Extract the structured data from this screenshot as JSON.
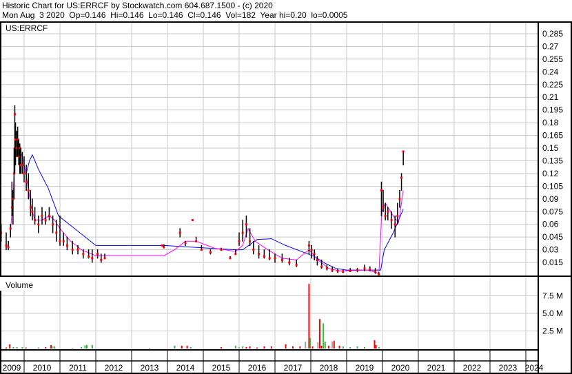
{
  "header": {
    "line1": "Historic Chart for US:ERRCF by Stockwatch.com 604.687.1500 - (c) 2020",
    "line2": "Mon Aug  3 2020  Op=0.146  Hi=0.146  Lo=0.146  Cl=0.146  Vol=182  Year hi=0.20  lo=0.0005"
  },
  "colors": {
    "grid": "#c8c8c8",
    "bar": "#000000",
    "close": "#ff0000",
    "ma_long": "#0000ff",
    "ma_short": "#ff00ff",
    "vol_down": "#ff0000",
    "vol_up": "#3cb43c",
    "vol_flat": "#a0a0a0"
  },
  "chart_data": [
    {
      "type": "line",
      "title": "US:ERRCF",
      "ylim": [
        0,
        0.3
      ],
      "yticks": [
        "0.015",
        "0.03",
        "0.045",
        "0.06",
        "0.075",
        "0.09",
        "0.105",
        "0.12",
        "0.135",
        "0.15",
        "0.165",
        "0.18",
        "0.195",
        "0.21",
        "0.225",
        "0.24",
        "0.255",
        "0.27",
        "0.285"
      ],
      "xlim": [
        2009.33,
        2024.45
      ],
      "xticks": [
        "2009",
        "2010",
        "2011",
        "2012",
        "2013",
        "2014",
        "2015",
        "2016",
        "2017",
        "2018",
        "2019",
        "2020",
        "2021",
        "2022",
        "2023",
        "2024"
      ],
      "ohlc_fields": [
        "year",
        "low",
        "high",
        "close"
      ],
      "bars": [
        [
          2009.33,
          0.045,
          0.095,
          0.09
        ],
        [
          2009.36,
          0.04,
          0.06,
          0.05
        ],
        [
          2009.5,
          0.03,
          0.05,
          0.035
        ],
        [
          2009.56,
          0.03,
          0.04,
          0.033
        ],
        [
          2009.62,
          0.045,
          0.06,
          0.055
        ],
        [
          2009.66,
          0.07,
          0.11,
          0.08
        ],
        [
          2009.69,
          0.06,
          0.1,
          0.09
        ],
        [
          2009.72,
          0.09,
          0.15,
          0.12
        ],
        [
          2009.74,
          0.12,
          0.2,
          0.19
        ],
        [
          2009.76,
          0.13,
          0.18,
          0.16
        ],
        [
          2009.79,
          0.14,
          0.17,
          0.15
        ],
        [
          2009.82,
          0.14,
          0.175,
          0.16
        ],
        [
          2009.85,
          0.13,
          0.16,
          0.14
        ],
        [
          2009.88,
          0.12,
          0.155,
          0.15
        ],
        [
          2009.91,
          0.12,
          0.15,
          0.13
        ],
        [
          2009.95,
          0.12,
          0.145,
          0.13
        ],
        [
          2010.0,
          0.11,
          0.14,
          0.12
        ],
        [
          2010.06,
          0.1,
          0.13,
          0.11
        ],
        [
          2010.12,
          0.09,
          0.12,
          0.1
        ],
        [
          2010.18,
          0.07,
          0.1,
          0.08
        ],
        [
          2010.23,
          0.065,
          0.09,
          0.075
        ],
        [
          2010.3,
          0.06,
          0.08,
          0.065
        ],
        [
          2010.4,
          0.05,
          0.07,
          0.06
        ],
        [
          2010.5,
          0.06,
          0.08,
          0.07
        ],
        [
          2010.6,
          0.06,
          0.075,
          0.065
        ],
        [
          2010.7,
          0.065,
          0.08,
          0.07
        ],
        [
          2010.8,
          0.05,
          0.07,
          0.06
        ],
        [
          2010.9,
          0.04,
          0.065,
          0.05
        ],
        [
          2011.0,
          0.035,
          0.07,
          0.04
        ],
        [
          2011.1,
          0.035,
          0.05,
          0.04
        ],
        [
          2011.2,
          0.03,
          0.045,
          0.035
        ],
        [
          2011.35,
          0.025,
          0.04,
          0.03
        ],
        [
          2011.5,
          0.025,
          0.035,
          0.03
        ],
        [
          2011.65,
          0.02,
          0.03,
          0.025
        ],
        [
          2011.8,
          0.02,
          0.03,
          0.022
        ],
        [
          2011.9,
          0.015,
          0.03,
          0.02
        ],
        [
          2012.05,
          0.02,
          0.03,
          0.025
        ],
        [
          2012.15,
          0.015,
          0.025,
          0.018
        ],
        [
          2012.25,
          0.02,
          0.025,
          0.02
        ],
        [
          2013.85,
          0.035,
          0.035,
          0.035
        ],
        [
          2013.9,
          0.032,
          0.036,
          0.033
        ],
        [
          2014.35,
          0.045,
          0.055,
          0.05
        ],
        [
          2014.5,
          0.035,
          0.04,
          0.038
        ],
        [
          2014.7,
          0.065,
          0.065,
          0.065
        ],
        [
          2014.8,
          0.04,
          0.045,
          0.04
        ],
        [
          2014.95,
          0.03,
          0.035,
          0.03
        ],
        [
          2015.2,
          0.025,
          0.03,
          0.027
        ],
        [
          2015.5,
          0.03,
          0.032,
          0.03
        ],
        [
          2015.75,
          0.02,
          0.022,
          0.02
        ],
        [
          2015.9,
          0.025,
          0.03,
          0.025
        ],
        [
          2016.0,
          0.035,
          0.05,
          0.04
        ],
        [
          2016.1,
          0.04,
          0.065,
          0.05
        ],
        [
          2016.2,
          0.045,
          0.07,
          0.06
        ],
        [
          2016.3,
          0.035,
          0.055,
          0.04
        ],
        [
          2016.4,
          0.025,
          0.04,
          0.03
        ],
        [
          2016.55,
          0.02,
          0.035,
          0.025
        ],
        [
          2016.7,
          0.02,
          0.03,
          0.022
        ],
        [
          2016.85,
          0.018,
          0.03,
          0.02
        ],
        [
          2017.0,
          0.015,
          0.025,
          0.02
        ],
        [
          2017.2,
          0.015,
          0.025,
          0.018
        ],
        [
          2017.4,
          0.012,
          0.02,
          0.015
        ],
        [
          2017.6,
          0.01,
          0.018,
          0.012
        ],
        [
          2017.95,
          0.025,
          0.04,
          0.035
        ],
        [
          2018.02,
          0.02,
          0.035,
          0.03
        ],
        [
          2018.1,
          0.018,
          0.03,
          0.025
        ],
        [
          2018.18,
          0.012,
          0.022,
          0.018
        ],
        [
          2018.3,
          0.008,
          0.018,
          0.01
        ],
        [
          2018.45,
          0.006,
          0.012,
          0.008
        ],
        [
          2018.6,
          0.004,
          0.01,
          0.006
        ],
        [
          2018.75,
          0.003,
          0.007,
          0.005
        ],
        [
          2018.9,
          0.003,
          0.006,
          0.004
        ],
        [
          2019.1,
          0.004,
          0.008,
          0.005
        ],
        [
          2019.3,
          0.004,
          0.008,
          0.006
        ],
        [
          2019.5,
          0.005,
          0.012,
          0.008
        ],
        [
          2019.65,
          0.005,
          0.01,
          0.007
        ],
        [
          2019.8,
          0.002,
          0.008,
          0.004
        ],
        [
          2019.9,
          0.0005,
          0.003,
          0.001
        ],
        [
          2019.97,
          0.07,
          0.11,
          0.1
        ],
        [
          2020.02,
          0.075,
          0.1,
          0.08
        ],
        [
          2020.08,
          0.065,
          0.085,
          0.07
        ],
        [
          2020.15,
          0.065,
          0.08,
          0.075
        ],
        [
          2020.25,
          0.055,
          0.075,
          0.065
        ],
        [
          2020.35,
          0.045,
          0.07,
          0.06
        ],
        [
          2020.42,
          0.06,
          0.085,
          0.07
        ],
        [
          2020.48,
          0.08,
          0.1,
          0.09
        ],
        [
          2020.53,
          0.1,
          0.12,
          0.115
        ],
        [
          2020.58,
          0.13,
          0.146,
          0.146
        ]
      ],
      "ma_long": [
        [
          2010.06,
          0.12
        ],
        [
          2010.15,
          0.135
        ],
        [
          2010.23,
          0.142
        ],
        [
          2010.4,
          0.125
        ],
        [
          2010.67,
          0.103
        ],
        [
          2010.96,
          0.07
        ],
        [
          2011.44,
          0.054
        ],
        [
          2012.0,
          0.035
        ],
        [
          2013.9,
          0.035
        ],
        [
          2015.9,
          0.03
        ],
        [
          2016.1,
          0.03
        ],
        [
          2016.5,
          0.042
        ],
        [
          2016.9,
          0.043
        ],
        [
          2017.3,
          0.035
        ],
        [
          2017.8,
          0.027
        ],
        [
          2018.1,
          0.022
        ],
        [
          2018.4,
          0.014
        ],
        [
          2018.7,
          0.008
        ],
        [
          2019.0,
          0.006
        ],
        [
          2019.95,
          0.006
        ],
        [
          2020.05,
          0.03
        ],
        [
          2020.3,
          0.05
        ],
        [
          2020.58,
          0.078
        ]
      ],
      "ma_short": [
        [
          2009.62,
          0.05
        ],
        [
          2009.7,
          0.1
        ],
        [
          2009.76,
          0.17
        ],
        [
          2009.85,
          0.15
        ],
        [
          2009.95,
          0.14
        ],
        [
          2010.05,
          0.12
        ],
        [
          2010.2,
          0.08
        ],
        [
          2010.3,
          0.065
        ],
        [
          2010.5,
          0.065
        ],
        [
          2010.7,
          0.07
        ],
        [
          2010.85,
          0.065
        ],
        [
          2011.0,
          0.055
        ],
        [
          2011.3,
          0.04
        ],
        [
          2011.6,
          0.03
        ],
        [
          2012.0,
          0.023
        ],
        [
          2012.3,
          0.023
        ],
        [
          2013.9,
          0.023
        ],
        [
          2014.2,
          0.03
        ],
        [
          2014.5,
          0.04
        ],
        [
          2014.8,
          0.04
        ],
        [
          2015.3,
          0.032
        ],
        [
          2015.9,
          0.028
        ],
        [
          2016.1,
          0.035
        ],
        [
          2016.25,
          0.055
        ],
        [
          2016.45,
          0.04
        ],
        [
          2016.8,
          0.03
        ],
        [
          2017.2,
          0.02
        ],
        [
          2017.6,
          0.018
        ],
        [
          2017.95,
          0.03
        ],
        [
          2018.2,
          0.018
        ],
        [
          2018.5,
          0.008
        ],
        [
          2018.8,
          0.005
        ],
        [
          2019.6,
          0.006
        ],
        [
          2019.9,
          0.002
        ],
        [
          2019.98,
          0.075
        ],
        [
          2020.08,
          0.085
        ],
        [
          2020.3,
          0.07
        ],
        [
          2020.45,
          0.062
        ],
        [
          2020.58,
          0.1
        ]
      ]
    },
    {
      "type": "bar",
      "title": "Volume",
      "ylim": [
        0,
        10
      ],
      "yticks": [
        "2.5 M",
        "5.0 M",
        "7.5 M"
      ],
      "unit": "M",
      "fields": [
        "year",
        "volume_millions",
        "direction"
      ],
      "bars": [
        [
          2009.5,
          0.15,
          "down"
        ],
        [
          2009.6,
          0.6,
          "down"
        ],
        [
          2009.7,
          0.2,
          "up"
        ],
        [
          2009.8,
          0.2,
          "up"
        ],
        [
          2009.95,
          0.2,
          "up"
        ],
        [
          2010.05,
          0.15,
          "down"
        ],
        [
          2010.4,
          0.15,
          "up"
        ],
        [
          2010.6,
          0.2,
          "down"
        ],
        [
          2010.75,
          0.5,
          "down"
        ],
        [
          2010.8,
          0.3,
          "flat"
        ],
        [
          2010.85,
          0.3,
          "up"
        ],
        [
          2011.35,
          0.1,
          "up"
        ],
        [
          2011.6,
          0.2,
          "up"
        ],
        [
          2011.7,
          0.45,
          "up"
        ],
        [
          2011.75,
          0.5,
          "up"
        ],
        [
          2011.9,
          0.5,
          "up"
        ],
        [
          2013.5,
          0.1,
          "up"
        ],
        [
          2014.2,
          0.4,
          "up"
        ],
        [
          2014.4,
          0.4,
          "down"
        ],
        [
          2014.55,
          0.4,
          "down"
        ],
        [
          2014.65,
          0.2,
          "up"
        ],
        [
          2015.5,
          0.2,
          "down"
        ],
        [
          2015.9,
          0.4,
          "up"
        ],
        [
          2016.0,
          0.2,
          "flat"
        ],
        [
          2016.1,
          0.3,
          "up"
        ],
        [
          2016.2,
          0.2,
          "down"
        ],
        [
          2016.3,
          0.3,
          "down"
        ],
        [
          2016.5,
          0.15,
          "down"
        ],
        [
          2016.7,
          0.3,
          "down"
        ],
        [
          2016.9,
          0.3,
          "down"
        ],
        [
          2017.3,
          0.6,
          "down"
        ],
        [
          2017.5,
          0.3,
          "down"
        ],
        [
          2017.7,
          0.3,
          "down"
        ],
        [
          2017.85,
          1.0,
          "flat"
        ],
        [
          2017.95,
          9.2,
          "down"
        ],
        [
          2017.98,
          1.5,
          "up"
        ],
        [
          2018.05,
          0.3,
          "down"
        ],
        [
          2018.2,
          0.9,
          "flat"
        ],
        [
          2018.25,
          4.2,
          "down"
        ],
        [
          2018.3,
          0.4,
          "down"
        ],
        [
          2018.35,
          3.6,
          "up"
        ],
        [
          2018.4,
          1.0,
          "up"
        ],
        [
          2018.5,
          0.4,
          "down"
        ],
        [
          2018.6,
          1.0,
          "flat"
        ],
        [
          2018.65,
          1.1,
          "down"
        ],
        [
          2018.8,
          0.4,
          "down"
        ],
        [
          2018.9,
          0.3,
          "up"
        ],
        [
          2019.1,
          0.2,
          "up"
        ],
        [
          2019.3,
          0.3,
          "up"
        ],
        [
          2019.5,
          0.2,
          "up"
        ],
        [
          2019.78,
          1.2,
          "down"
        ],
        [
          2019.82,
          0.5,
          "down"
        ],
        [
          2019.9,
          0.2,
          "up"
        ]
      ]
    }
  ]
}
